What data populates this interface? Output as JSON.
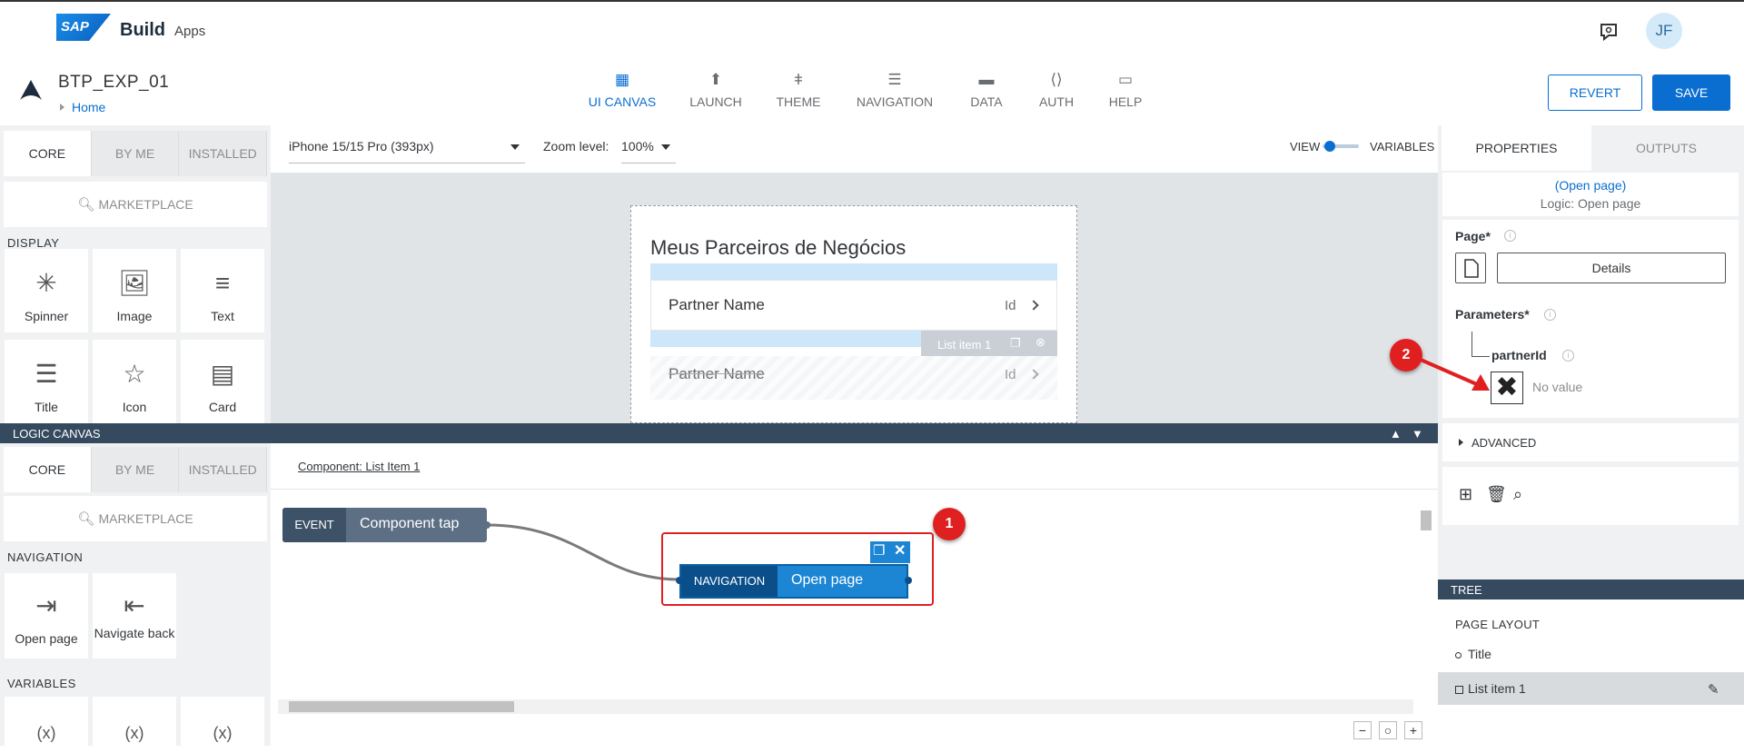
{
  "header": {
    "logo_text": "SAP",
    "product": "Build",
    "product_sub": "Apps",
    "user_initials": "JF"
  },
  "app": {
    "name": "BTP_EXP_01",
    "breadcrumb": "Home"
  },
  "nav_tabs": [
    {
      "label": "UI CANVAS",
      "icon": "ui-canvas-icon"
    },
    {
      "label": "LAUNCH",
      "icon": "launch-icon"
    },
    {
      "label": "THEME",
      "icon": "theme-icon"
    },
    {
      "label": "NAVIGATION",
      "icon": "navigation-icon"
    },
    {
      "label": "DATA",
      "icon": "data-icon"
    },
    {
      "label": "AUTH",
      "icon": "auth-icon"
    },
    {
      "label": "HELP",
      "icon": "help-icon"
    }
  ],
  "actions": {
    "revert": "REVERT",
    "save": "SAVE"
  },
  "palette_top": {
    "tabs": [
      "CORE",
      "BY ME",
      "INSTALLED"
    ],
    "marketplace": "MARKETPLACE",
    "section": "DISPLAY",
    "items": [
      "Spinner",
      "Image",
      "Text",
      "Title",
      "Icon",
      "Card"
    ]
  },
  "device_bar": {
    "device": "iPhone 15/15 Pro (393px)",
    "zoom_label": "Zoom level:",
    "zoom": "100%",
    "view": "VIEW",
    "variables": "VARIABLES"
  },
  "phone": {
    "title": "Meus Parceiros de Negócios",
    "row1_name": "Partner Name",
    "row1_id": "Id",
    "list_item_label": "List item 1",
    "row2_name": "Partner Name",
    "row2_id": "Id"
  },
  "logic": {
    "bar_title": "LOGIC CANVAS",
    "tabs": [
      "CORE",
      "BY ME",
      "INSTALLED"
    ],
    "marketplace": "MARKETPLACE",
    "section_nav": "NAVIGATION",
    "nav_items": [
      "Open page",
      "Navigate back"
    ],
    "section_vars": "VARIABLES",
    "component_label": "Component: List Item 1",
    "event_tag": "EVENT",
    "event_label": "Component tap",
    "nav_tag": "NAVIGATION",
    "nav_label": "Open page",
    "badge1": "1"
  },
  "properties": {
    "tabs": [
      "PROPERTIES",
      "OUTPUTS"
    ],
    "title": "(Open page)",
    "subtitle": "Logic: Open page",
    "page_label": "Page*",
    "page_value": "Details",
    "params_label": "Parameters*",
    "param_name": "partnerId",
    "param_value": "No value",
    "advanced": "ADVANCED",
    "badge2": "2"
  },
  "tree": {
    "bar_title": "TREE",
    "section": "PAGE LAYOUT",
    "items": [
      "Title",
      "List item 1"
    ]
  },
  "colors": {
    "accent": "#0a6ed1",
    "annotation": "#e02020",
    "bar": "#354a5f"
  }
}
